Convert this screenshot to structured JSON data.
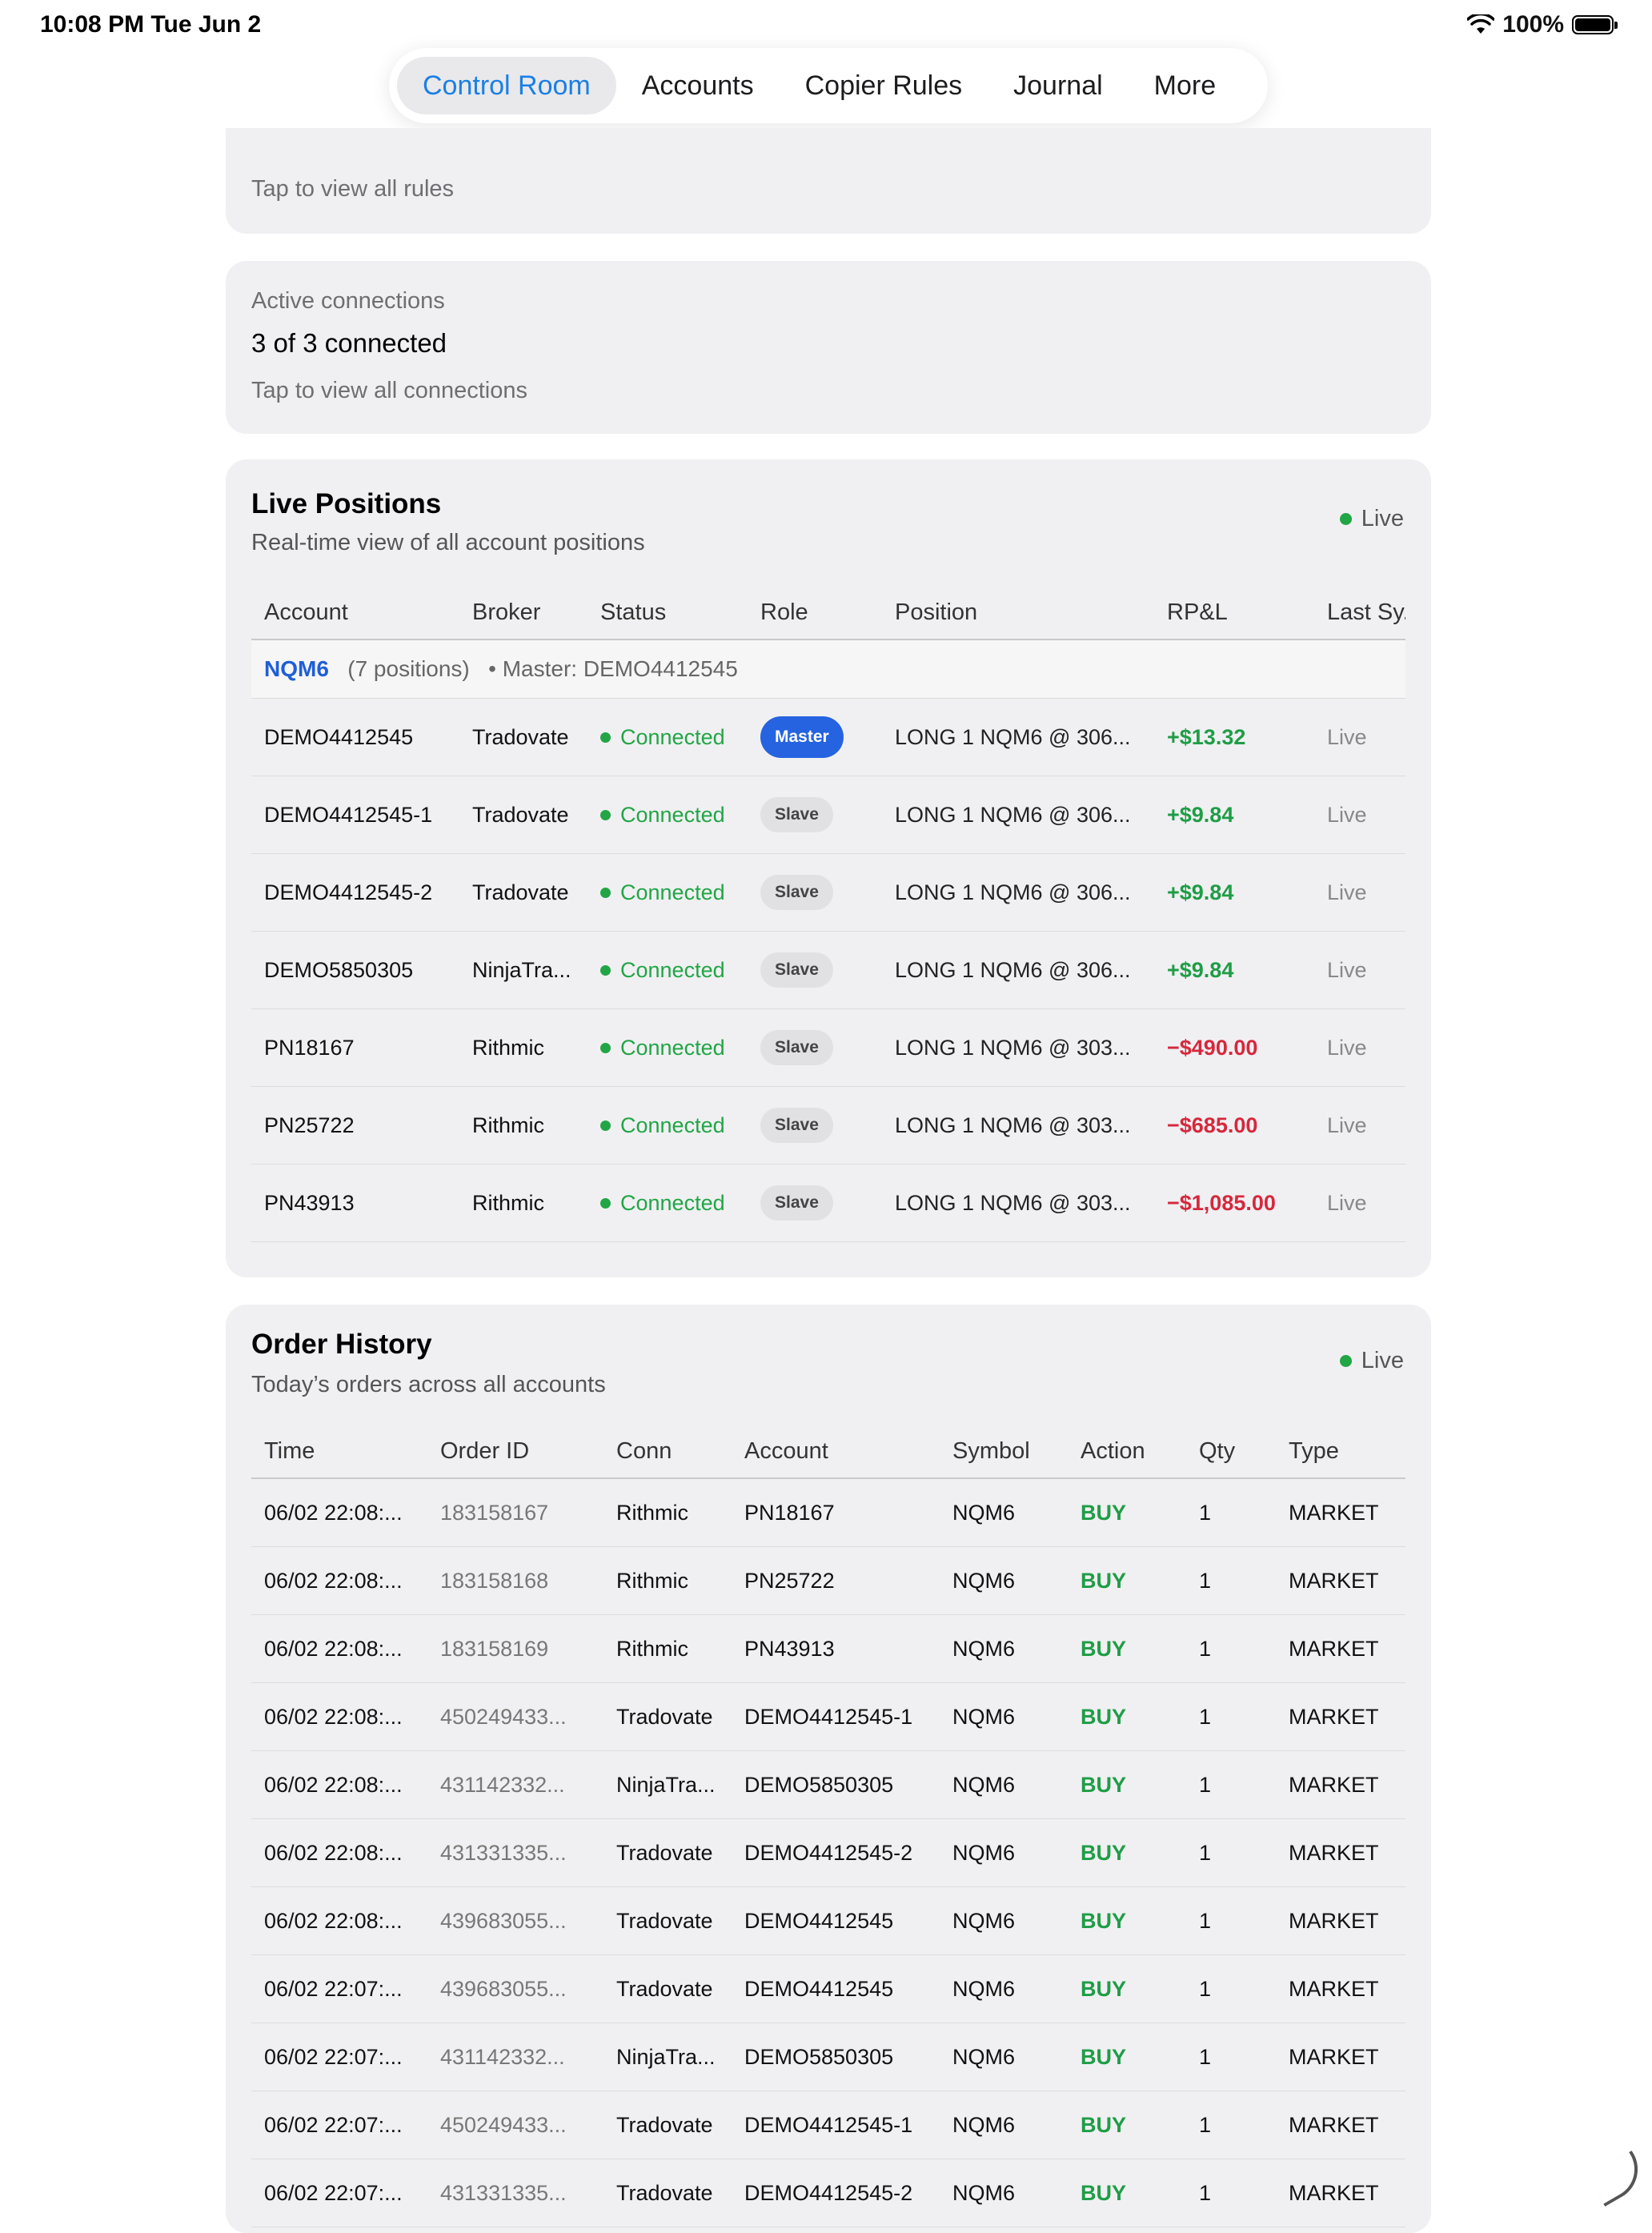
{
  "status_bar": {
    "time": "10:08 PM  Tue Jun 2",
    "battery": "100%"
  },
  "nav": {
    "tabs": [
      "Control Room",
      "Accounts",
      "Copier Rules",
      "Journal",
      "More"
    ],
    "active": "Control Room"
  },
  "rules_card": {
    "hint": "Tap to view all rules"
  },
  "connections_card": {
    "label": "Active connections",
    "value": "3 of 3 connected",
    "hint": "Tap to view all connections"
  },
  "live_positions": {
    "title": "Live Positions",
    "subtitle": "Real-time view of all account positions",
    "live_label": "Live",
    "columns": [
      "Account",
      "Broker",
      "Status",
      "Role",
      "Position",
      "RP&L",
      "Last Sy."
    ],
    "group": {
      "symbol": "NQM6",
      "count": "(7 positions)",
      "master": "• Master: DEMO4412545"
    },
    "rows": [
      {
        "account": "DEMO4412545",
        "broker": "Tradovate",
        "status": "Connected",
        "role": "Master",
        "position": "LONG 1 NQM6 @ 306...",
        "rpl": "+$13.32",
        "rpl_sign": "gain",
        "last": "Live"
      },
      {
        "account": "DEMO4412545-1",
        "broker": "Tradovate",
        "status": "Connected",
        "role": "Slave",
        "position": "LONG 1 NQM6 @ 306...",
        "rpl": "+$9.84",
        "rpl_sign": "gain",
        "last": "Live"
      },
      {
        "account": "DEMO4412545-2",
        "broker": "Tradovate",
        "status": "Connected",
        "role": "Slave",
        "position": "LONG 1 NQM6 @ 306...",
        "rpl": "+$9.84",
        "rpl_sign": "gain",
        "last": "Live"
      },
      {
        "account": "DEMO5850305",
        "broker": "NinjaTra...",
        "status": "Connected",
        "role": "Slave",
        "position": "LONG 1 NQM6 @ 306...",
        "rpl": "+$9.84",
        "rpl_sign": "gain",
        "last": "Live"
      },
      {
        "account": "PN18167",
        "broker": "Rithmic",
        "status": "Connected",
        "role": "Slave",
        "position": "LONG 1 NQM6 @ 303...",
        "rpl": "−$490.00",
        "rpl_sign": "loss",
        "last": "Live"
      },
      {
        "account": "PN25722",
        "broker": "Rithmic",
        "status": "Connected",
        "role": "Slave",
        "position": "LONG 1 NQM6 @ 303...",
        "rpl": "−$685.00",
        "rpl_sign": "loss",
        "last": "Live"
      },
      {
        "account": "PN43913",
        "broker": "Rithmic",
        "status": "Connected",
        "role": "Slave",
        "position": "LONG 1 NQM6 @ 303...",
        "rpl": "−$1,085.00",
        "rpl_sign": "loss",
        "last": "Live"
      }
    ]
  },
  "order_history": {
    "title": "Order History",
    "subtitle": "Today’s orders across all accounts",
    "live_label": "Live",
    "columns": [
      "Time",
      "Order ID",
      "Conn",
      "Account",
      "Symbol",
      "Action",
      "Qty",
      "Type"
    ],
    "rows": [
      {
        "time": "06/02 22:08:...",
        "order_id": "183158167",
        "conn": "Rithmic",
        "account": "PN18167",
        "symbol": "NQM6",
        "action": "BUY",
        "qty": "1",
        "type": "MARKET"
      },
      {
        "time": "06/02 22:08:...",
        "order_id": "183158168",
        "conn": "Rithmic",
        "account": "PN25722",
        "symbol": "NQM6",
        "action": "BUY",
        "qty": "1",
        "type": "MARKET"
      },
      {
        "time": "06/02 22:08:...",
        "order_id": "183158169",
        "conn": "Rithmic",
        "account": "PN43913",
        "symbol": "NQM6",
        "action": "BUY",
        "qty": "1",
        "type": "MARKET"
      },
      {
        "time": "06/02 22:08:...",
        "order_id": "450249433...",
        "conn": "Tradovate",
        "account": "DEMO4412545-1",
        "symbol": "NQM6",
        "action": "BUY",
        "qty": "1",
        "type": "MARKET"
      },
      {
        "time": "06/02 22:08:...",
        "order_id": "431142332...",
        "conn": "NinjaTra...",
        "account": "DEMO5850305",
        "symbol": "NQM6",
        "action": "BUY",
        "qty": "1",
        "type": "MARKET"
      },
      {
        "time": "06/02 22:08:...",
        "order_id": "431331335...",
        "conn": "Tradovate",
        "account": "DEMO4412545-2",
        "symbol": "NQM6",
        "action": "BUY",
        "qty": "1",
        "type": "MARKET"
      },
      {
        "time": "06/02 22:08:...",
        "order_id": "439683055...",
        "conn": "Tradovate",
        "account": "DEMO4412545",
        "symbol": "NQM6",
        "action": "BUY",
        "qty": "1",
        "type": "MARKET"
      },
      {
        "time": "06/02 22:07:...",
        "order_id": "439683055...",
        "conn": "Tradovate",
        "account": "DEMO4412545",
        "symbol": "NQM6",
        "action": "BUY",
        "qty": "1",
        "type": "MARKET"
      },
      {
        "time": "06/02 22:07:...",
        "order_id": "431142332...",
        "conn": "NinjaTra...",
        "account": "DEMO5850305",
        "symbol": "NQM6",
        "action": "BUY",
        "qty": "1",
        "type": "MARKET"
      },
      {
        "time": "06/02 22:07:...",
        "order_id": "450249433...",
        "conn": "Tradovate",
        "account": "DEMO4412545-1",
        "symbol": "NQM6",
        "action": "BUY",
        "qty": "1",
        "type": "MARKET"
      },
      {
        "time": "06/02 22:07:...",
        "order_id": "431331335...",
        "conn": "Tradovate",
        "account": "DEMO4412545-2",
        "symbol": "NQM6",
        "action": "BUY",
        "qty": "1",
        "type": "MARKET"
      }
    ]
  }
}
